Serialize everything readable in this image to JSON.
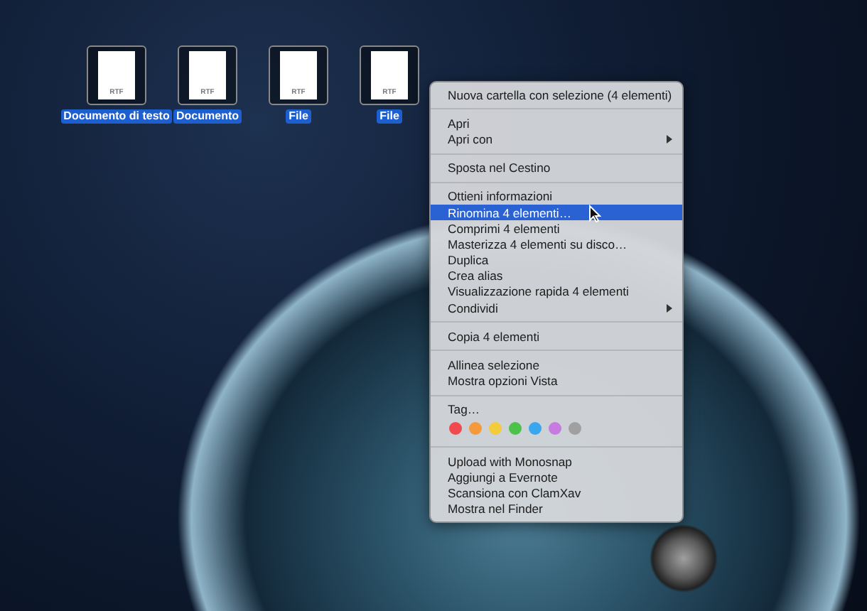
{
  "desktop_icons": [
    {
      "badge": "RTF",
      "label": "Documento di testo",
      "selected": true
    },
    {
      "badge": "RTF",
      "label": "Documento",
      "selected": true
    },
    {
      "badge": "RTF",
      "label": "File",
      "selected": true
    },
    {
      "badge": "RTF",
      "label": "File",
      "selected": true
    }
  ],
  "context_menu": {
    "groups": [
      {
        "items": [
          {
            "kind": "item",
            "label": "Nuova cartella con selezione (4 elementi)",
            "selected": false
          }
        ]
      },
      {
        "items": [
          {
            "kind": "item",
            "label": "Apri",
            "selected": false
          },
          {
            "kind": "submenu",
            "label": "Apri con",
            "selected": false
          }
        ]
      },
      {
        "items": [
          {
            "kind": "item",
            "label": "Sposta nel Cestino",
            "selected": false
          }
        ]
      },
      {
        "items": [
          {
            "kind": "item",
            "label": "Ottieni informazioni",
            "selected": false
          },
          {
            "kind": "item",
            "label": "Rinomina 4 elementi…",
            "selected": true
          },
          {
            "kind": "item",
            "label": "Comprimi 4 elementi",
            "selected": false
          },
          {
            "kind": "item",
            "label": "Masterizza 4 elementi su disco…",
            "selected": false
          },
          {
            "kind": "item",
            "label": "Duplica",
            "selected": false
          },
          {
            "kind": "item",
            "label": "Crea alias",
            "selected": false
          },
          {
            "kind": "item",
            "label": "Visualizzazione rapida 4 elementi",
            "selected": false
          },
          {
            "kind": "submenu",
            "label": "Condividi",
            "selected": false
          }
        ]
      },
      {
        "items": [
          {
            "kind": "item",
            "label": "Copia 4 elementi",
            "selected": false
          }
        ]
      },
      {
        "items": [
          {
            "kind": "item",
            "label": "Allinea selezione",
            "selected": false
          },
          {
            "kind": "item",
            "label": "Mostra opzioni Vista",
            "selected": false
          }
        ]
      },
      {
        "items": [
          {
            "kind": "item",
            "label": "Tag…",
            "selected": false
          },
          {
            "kind": "tags",
            "tags": [
              {
                "color": "#f04a4f"
              },
              {
                "color": "#f59a3a"
              },
              {
                "color": "#f2cc3b"
              },
              {
                "color": "#4cc24a"
              },
              {
                "color": "#3aa6ee"
              },
              {
                "color": "#c77be0"
              },
              {
                "color": "#a0a0a0"
              }
            ]
          }
        ]
      },
      {
        "items": [
          {
            "kind": "item",
            "label": "Upload with Monosnap",
            "selected": false
          },
          {
            "kind": "item",
            "label": "Aggiungi a Evernote",
            "selected": false
          },
          {
            "kind": "item",
            "label": "Scansiona con ClamXav",
            "selected": false
          },
          {
            "kind": "item",
            "label": "Mostra nel Finder",
            "selected": false
          }
        ]
      }
    ]
  }
}
